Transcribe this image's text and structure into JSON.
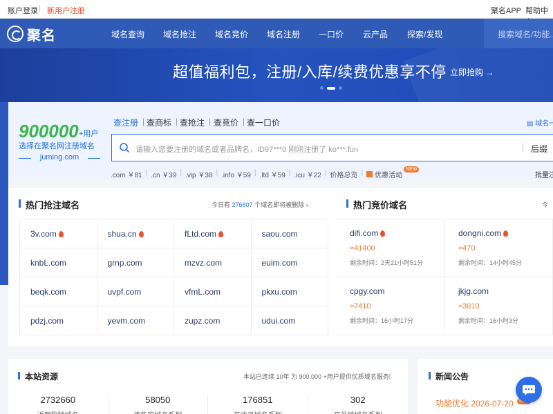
{
  "topbar": {
    "login": "账户登录",
    "separator": "|",
    "register": "新用户注册",
    "app": "聚名APP",
    "help": "帮助中心"
  },
  "nav": {
    "logo": "聚名",
    "items": [
      "域名查询",
      "域名抢注",
      "域名竞价",
      "域名注册",
      "一口价",
      "云产品",
      "探索/发现"
    ],
    "search_placeholder": "搜索域名/功能..."
  },
  "banner": {
    "text": "超值福利包，注册/入库/续费优惠享不停",
    "cta": "立即抢购 →"
  },
  "stats": {
    "number": "900000",
    "unit": "+用户",
    "desc": "选择在聚名网注册域名",
    "site": "juming.com"
  },
  "search": {
    "tabs": [
      "查注册",
      "查商标",
      "查抢注",
      "查竞价",
      "查一口价"
    ],
    "active_tab": "查注册",
    "batch_link": "域名一",
    "placeholder": "请输入您要注册的域名或者品牌名，ID97***0 刚刚注册了 ko***.fun",
    "suffix": "后缀",
    "prices": [
      ".com ￥81",
      ".cn ￥39",
      ".vip ￥38",
      ".info ￥59",
      ".ltd ￥59",
      ".icu ￥22",
      "价格总览"
    ],
    "promo": "优惠活动",
    "promo_badge": "NEW",
    "bulk": "批量注"
  },
  "hot_grab": {
    "title": "热门抢注域名",
    "meta_prefix": "今日有",
    "meta_count": "276607",
    "meta_suffix": "个域名即将被删除",
    "domains": [
      {
        "name": "3v.com",
        "hot": true
      },
      {
        "name": "shua.cn",
        "hot": true
      },
      {
        "name": "fLtd.com",
        "hot": true
      },
      {
        "name": "saou.com",
        "hot": false
      },
      {
        "name": "knbL.com",
        "hot": false
      },
      {
        "name": "grnp.com",
        "hot": false
      },
      {
        "name": "mzvz.com",
        "hot": false
      },
      {
        "name": "euim.com",
        "hot": false
      },
      {
        "name": "beqk.com",
        "hot": false
      },
      {
        "name": "uvpf.com",
        "hot": false
      },
      {
        "name": "vfmL.com",
        "hot": false
      },
      {
        "name": "pkxu.com",
        "hot": false
      },
      {
        "name": "pdzj.com",
        "hot": false
      },
      {
        "name": "yevm.com",
        "hot": false
      },
      {
        "name": "zupz.com",
        "hot": false
      },
      {
        "name": "udui.com",
        "hot": false
      }
    ]
  },
  "hot_bid": {
    "title": "热门竞价域名",
    "meta": "今",
    "items": [
      {
        "name": "difi.com",
        "hot": true,
        "price": "≈41400",
        "time": "剩余时间：2天21小时51分"
      },
      {
        "name": "dongni.com",
        "hot": true,
        "price": "≈470",
        "time": "剩余时间：14小时45分"
      },
      {
        "name": "cpgy.com",
        "hot": false,
        "price": "≈7410",
        "time": "剩余时间：16小时17分"
      },
      {
        "name": "jkjg.com",
        "hot": false,
        "price": "≈3010",
        "time": "剩余时间：16小时3分"
      }
    ]
  },
  "resources": {
    "title": "本站资源",
    "meta": "本站已连续 10年 为 900,000 +用户提供优质域名服务!",
    "stats": [
      {
        "value": "2732660",
        "label": "近期删除域名"
      },
      {
        "value": "58050",
        "label": "待售实域名系列"
      },
      {
        "value": "176851",
        "label": "高收录域名系列"
      },
      {
        "value": "302",
        "label": "高外链域名系列"
      }
    ]
  },
  "news": {
    "title": "新闻公告",
    "item": "功能优化 2026-07-20",
    "badge": "NEW"
  },
  "colors": {
    "nav": "#2f5bb7",
    "accent": "#2f6fd6",
    "price": "#f07a2f",
    "green": "#3bb54a"
  }
}
